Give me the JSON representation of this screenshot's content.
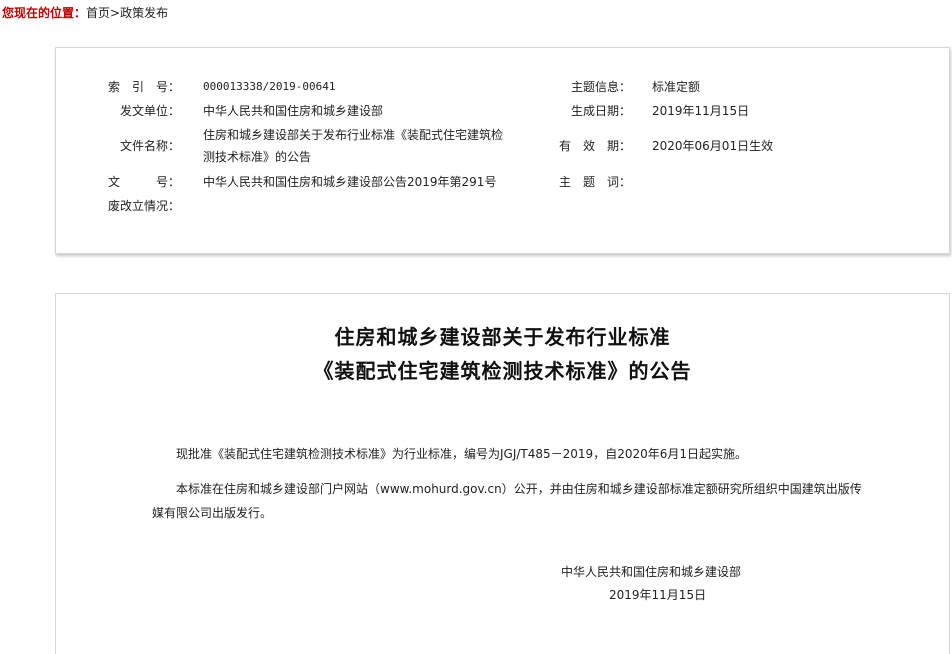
{
  "breadcrumb": {
    "label": "您现在的位置：",
    "home": "首页",
    "separator": ">",
    "current": "政策发布"
  },
  "meta": {
    "index_label": "索　引　号：",
    "index_value": "000013338/2019-00641",
    "topic_label": "主题信息：",
    "topic_value": "标准定额",
    "issuer_label": "发文单位：",
    "issuer_value": "中华人民共和国住房和城乡建设部",
    "date_label": "生成日期：",
    "date_value": "2019年11月15日",
    "filename_label": "文件名称：",
    "filename_line1": "住房和城乡建设部关于发布行业标准《装配式住宅建筑检",
    "filename_line2": "测技术标准》的公告",
    "validity_label": "有　效　期：",
    "validity_value": "2020年06月01日生效",
    "docno_label": "文　　　号：",
    "docno_value": "中华人民共和国住房和城乡建设部公告2019年第291号",
    "keyword_label": "主　题　词：",
    "keyword_value": "",
    "status_label": "废改立情况：",
    "status_value": ""
  },
  "article": {
    "title_line1": "住房和城乡建设部关于发布行业标准",
    "title_line2": "《装配式住宅建筑检测技术标准》的公告",
    "para1": "现批准《装配式住宅建筑检测技术标准》为行业标准，编号为JGJ/T485－2019，自2020年6月1日起实施。",
    "para2_line1": "本标准在住房和城乡建设部门户网站（www.mohurd.gov.cn）公开，并由住房和城乡建设部标准定额研究所组织中国建筑出版传",
    "para2_line2": "媒有限公司出版发行。",
    "signer": "中华人民共和国住房和城乡建设部",
    "sign_date": "2019年11月15日"
  },
  "colors": {
    "breadcrumb_label": "#c00000",
    "border": "#d6d6d6",
    "text": "#222222"
  }
}
